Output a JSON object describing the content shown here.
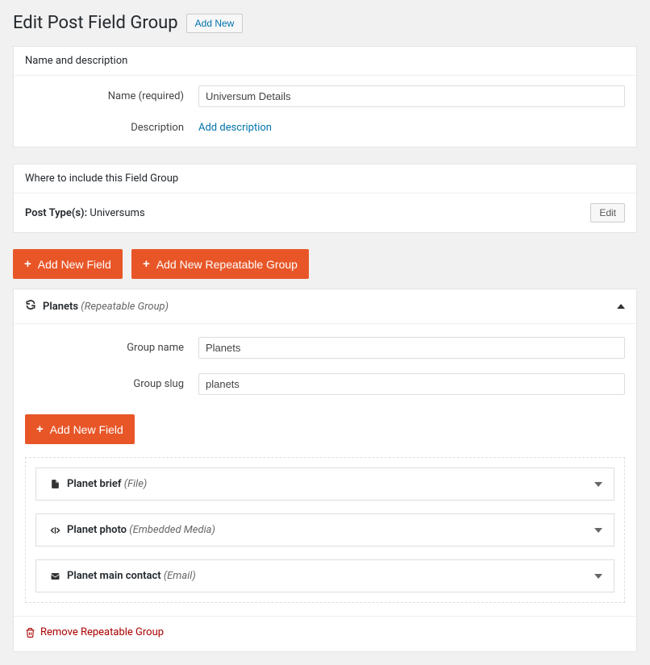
{
  "page": {
    "title": "Edit Post Field Group",
    "add_new": "Add New"
  },
  "name_panel": {
    "header": "Name and description",
    "name_label": "Name (required)",
    "name_value": "Universum Details",
    "desc_label": "Description",
    "desc_link": "Add description"
  },
  "include_panel": {
    "header": "Where to include this Field Group",
    "post_type_label": "Post Type(s):",
    "post_type_value": "Universums",
    "edit": "Edit"
  },
  "buttons": {
    "add_field": "Add New Field",
    "add_group": "Add New Repeatable Group"
  },
  "group": {
    "title": "Planets",
    "title_hint": "(Repeatable Group)",
    "name_label": "Group name",
    "name_value": "Planets",
    "slug_label": "Group slug",
    "slug_value": "planets",
    "add_field": "Add New Field",
    "remove": "Remove Repeatable Group",
    "fields": [
      {
        "title": "Planet brief",
        "hint": "(File)",
        "icon": "file"
      },
      {
        "title": "Planet photo",
        "hint": "(Embedded Media)",
        "icon": "code"
      },
      {
        "title": "Planet main contact",
        "hint": "(Email)",
        "icon": "mail"
      }
    ]
  }
}
